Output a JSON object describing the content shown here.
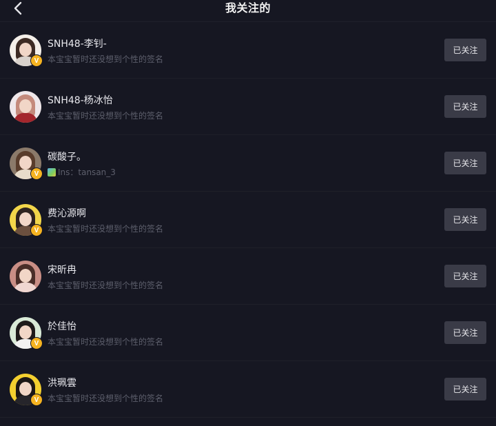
{
  "header": {
    "title": "我关注的",
    "back_icon": "chevron-left-icon"
  },
  "follow_button_label": "已关注",
  "verified_badge": "V",
  "colors": {
    "background": "#161722",
    "button": "#3a3b47",
    "badge": "#f6b320",
    "name_text": "#e9e9ee",
    "signature_text": "#5d5f6c"
  },
  "users": [
    {
      "name": "SNH48-李钊-",
      "signature": "本宝宝暂时还没想到个性的签名",
      "verified": true,
      "sig_icon": false,
      "avatar_bg": "#f4efe9",
      "hair": "#3d2b24",
      "outfit": "#d9d2cc"
    },
    {
      "name": "SNH48-杨冰怡",
      "signature": "本宝宝暂时还没想到个性的签名",
      "verified": false,
      "sig_icon": false,
      "avatar_bg": "#efe7ea",
      "hair": "#c48a7c",
      "outfit": "#a4262c"
    },
    {
      "name": "碳酸子。",
      "signature": "Ins：tansan_3",
      "verified": true,
      "sig_icon": true,
      "avatar_bg": "#8b7a6a",
      "hair": "#5a3d2c",
      "outfit": "#e8dccb"
    },
    {
      "name": "费沁源啊",
      "signature": "本宝宝暂时还没想到个性的签名",
      "verified": true,
      "sig_icon": false,
      "avatar_bg": "#f2d64a",
      "hair": "#2e2320",
      "outfit": "#6b4f3e"
    },
    {
      "name": "宋昕冉",
      "signature": "本宝宝暂时还没想到个性的签名",
      "verified": false,
      "sig_icon": false,
      "avatar_bg": "#c98e85",
      "hair": "#4a2e28",
      "outfit": "#f0d7d1"
    },
    {
      "name": "於佳怡",
      "signature": "本宝宝暂时还没想到个性的签名",
      "verified": true,
      "sig_icon": false,
      "avatar_bg": "#d9ead7",
      "hair": "#1e1a1a",
      "outfit": "#f2f2f2"
    },
    {
      "name": "洪珮雲",
      "signature": "本宝宝暂时还没想到个性的签名",
      "verified": true,
      "sig_icon": false,
      "avatar_bg": "#f3cf2f",
      "hair": "#1c1716",
      "outfit": "#26252b"
    }
  ]
}
